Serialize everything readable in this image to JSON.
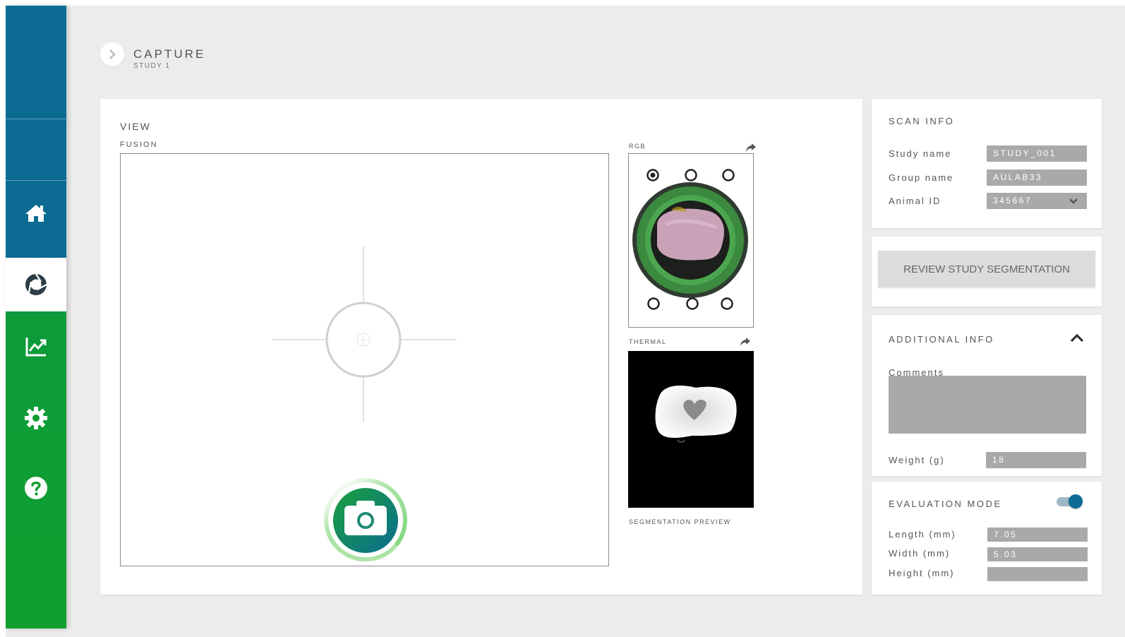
{
  "header": {
    "title": "CAPTURE",
    "subtitle": "STUDY 1"
  },
  "sidebar": {
    "items": [
      {
        "icon": "home-icon",
        "active": false
      },
      {
        "icon": "capture-aperture-icon",
        "active": true
      },
      {
        "icon": "chart-icon",
        "active": false
      },
      {
        "icon": "gear-icon",
        "active": false
      },
      {
        "icon": "help-icon",
        "active": false
      }
    ]
  },
  "view": {
    "title": "VIEW",
    "fusion_label": "FUSION",
    "rgb_label": "RGB",
    "thermal_label": "THERMAL",
    "segmentation_label": "SEGMENTATION PREVIEW"
  },
  "scan_info": {
    "title": "SCAN INFO",
    "study_name_label": "Study name",
    "study_name_value": "STUDY_001",
    "group_name_label": "Group name",
    "group_name_value": "AULAB33",
    "animal_id_label": "Animal ID",
    "animal_id_value": "345667"
  },
  "review": {
    "button_label": "REVIEW STUDY SEGMENTATION"
  },
  "additional_info": {
    "title": "ADDITIONAL INFO",
    "comments_label": "Comments",
    "comments_value": "",
    "weight_label": "Weight (g)",
    "weight_value": "18"
  },
  "evaluation": {
    "title": "EVALUATION MODE",
    "enabled": true,
    "length_label": "Length (mm)",
    "length_value": "7.05",
    "width_label": "Width (mm)",
    "width_value": "5.03",
    "height_label": "Height (mm)",
    "height_value": ""
  },
  "colors": {
    "sidebar_blue": "#0b6b93",
    "sidebar_green": "#109e2d",
    "field_gray": "#a9a9a9",
    "accent": "#0b6b93"
  }
}
